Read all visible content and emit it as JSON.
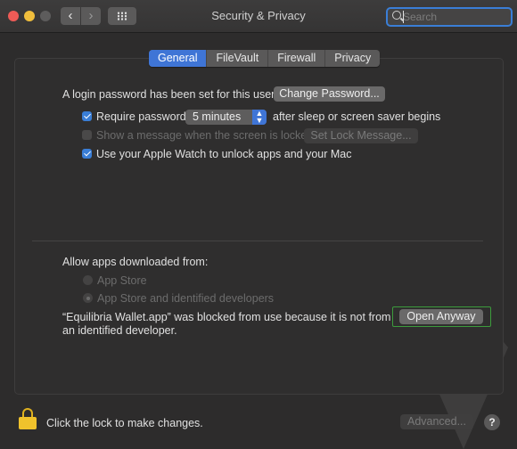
{
  "window": {
    "title": "Security & Privacy",
    "search_placeholder": "Search"
  },
  "tabs": [
    {
      "label": "General",
      "active": true
    },
    {
      "label": "FileVault",
      "active": false
    },
    {
      "label": "Firewall",
      "active": false
    },
    {
      "label": "Privacy",
      "active": false
    }
  ],
  "general": {
    "login_password_text": "A login password has been set for this user",
    "change_password_label": "Change Password...",
    "require_password_label": "Require password",
    "require_password_checked": true,
    "require_password_delay": "5 minutes",
    "after_sleep_text": "after sleep or screen saver begins",
    "show_message_label": "Show a message when the screen is locked",
    "show_message_checked": false,
    "set_lock_message_label": "Set Lock Message...",
    "apple_watch_label": "Use your Apple Watch to unlock apps and your Mac",
    "apple_watch_checked": true
  },
  "downloads": {
    "heading": "Allow apps downloaded from:",
    "option_app_store": "App Store",
    "option_identified": "App Store and identified developers",
    "blocked_line1": "“Equilibria Wallet.app” was blocked from use because it is not from",
    "blocked_line2": "an identified developer.",
    "open_anyway_label": "Open Anyway"
  },
  "footer": {
    "lock_text": "Click the lock to make changes.",
    "advanced_label": "Advanced...",
    "help_label": "?"
  },
  "colors": {
    "accent": "#3f75d6",
    "lock_yellow": "#f0c22c",
    "highlight_green": "#3c9b3c"
  }
}
